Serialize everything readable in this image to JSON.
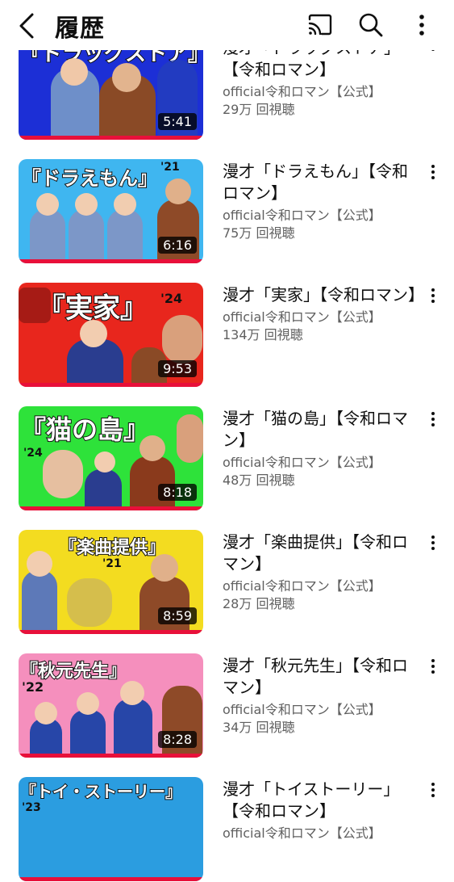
{
  "header": {
    "title": "履歴"
  },
  "icons": {
    "back": "chevron-left-icon",
    "cast": "cast-icon",
    "search": "search-icon",
    "menu": "more-vert-icon"
  },
  "colors": {
    "progress": "#e8103a",
    "text": "#0f0f0f",
    "meta": "#606060"
  },
  "videos": [
    {
      "title": "漫才「ドラッグストア」【令和ロマン】",
      "thumb_text": "『ドラッグストア』",
      "year": "",
      "duration": "5:41",
      "channel": "official令和ロマン【公式】",
      "views": "29万 回視聴",
      "bg": "#1c2fd6"
    },
    {
      "title": "漫才「ドラえもん」【令和ロマン】",
      "thumb_text": "『ドラえもん』",
      "year": "'21",
      "duration": "6:16",
      "channel": "official令和ロマン【公式】",
      "views": "75万 回視聴",
      "bg": "#3fb6f0"
    },
    {
      "title": "漫才「実家」【令和ロマン】",
      "thumb_text": "『実家』",
      "year": "'24",
      "duration": "9:53",
      "channel": "official令和ロマン【公式】",
      "views": "134万 回視聴",
      "bg": "#e8261d"
    },
    {
      "title": "漫才「猫の島」【令和ロマン】",
      "thumb_text": "『猫の島』",
      "year": "'24",
      "duration": "8:18",
      "channel": "official令和ロマン【公式】",
      "views": "48万 回視聴",
      "bg": "#2ee23a"
    },
    {
      "title": "漫才「楽曲提供」【令和ロマン】",
      "thumb_text": "『楽曲提供』",
      "year": "'21",
      "duration": "8:59",
      "channel": "official令和ロマン【公式】",
      "views": "28万 回視聴",
      "bg": "#f3dc20"
    },
    {
      "title": "漫才「秋元先生」【令和ロマン】",
      "thumb_text": "『秋元先生』",
      "year": "'22",
      "duration": "8:28",
      "channel": "official令和ロマン【公式】",
      "views": "34万 回視聴",
      "bg": "#f58fbd"
    },
    {
      "title": "漫才「トイストーリー」【令和ロマン】",
      "thumb_text": "『トイ・ストーリー』",
      "year": "'23",
      "duration": "",
      "channel": "official令和ロマン【公式】",
      "views": "",
      "bg": "#2b9de0"
    }
  ]
}
